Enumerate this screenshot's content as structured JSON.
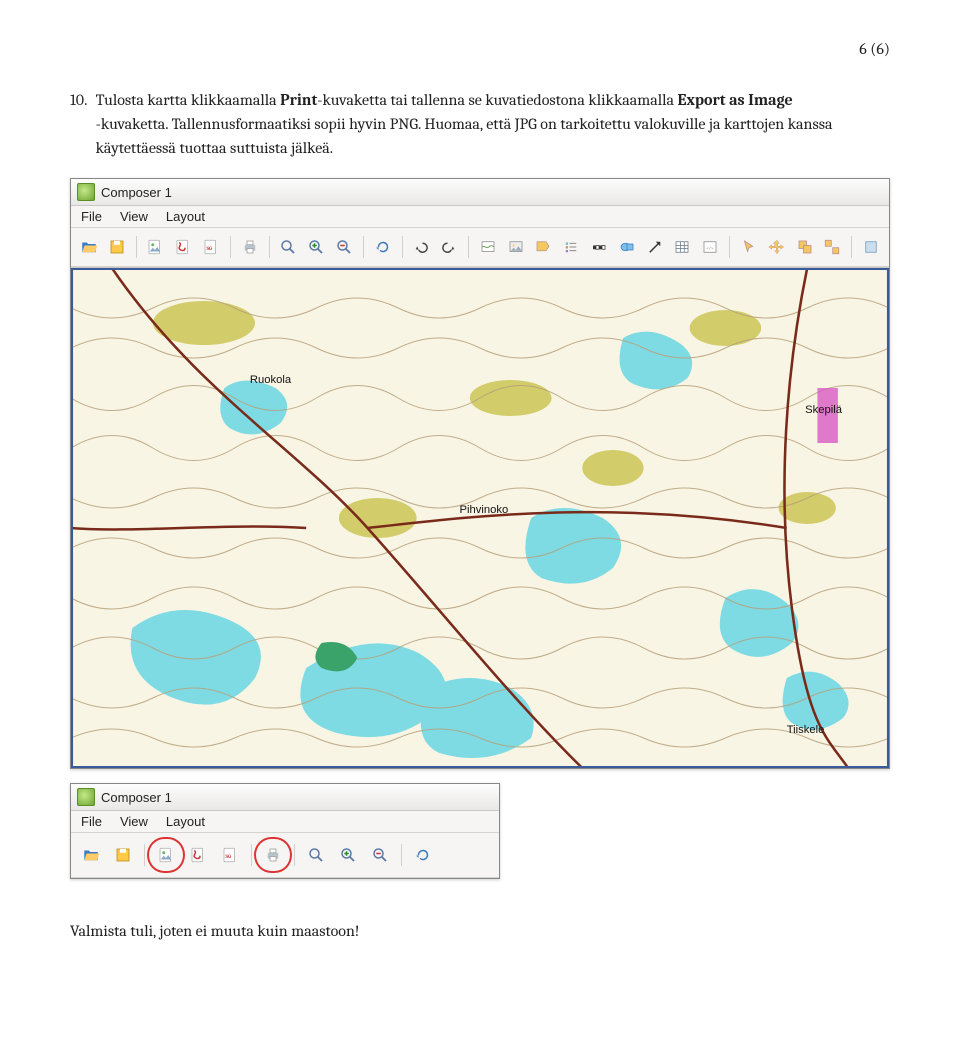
{
  "page_number": "6 (6)",
  "step": {
    "num": "10.",
    "text_before_bold1": "Tulosta kartta klikkaamalla ",
    "bold1": "Print",
    "text_mid1": "-kuvaketta tai tallenna se kuvatiedostona klikkaamalla ",
    "bold2": "Export as Image",
    "text_after_bold2": " -kuvaketta. Tallennusformaatiksi sopii hyvin PNG. Huomaa, että JPG on tarkoitettu valokuville ja karttojen kanssa käytettäessä tuottaa suttuista jälkeä."
  },
  "composer": {
    "title": "Composer 1",
    "menu": [
      "File",
      "View",
      "Layout"
    ]
  },
  "final_line": "Valmista tuli, joten ei muuta kuin maastoon!",
  "icons": {
    "folder": "folder-open-icon",
    "save_project": "save-project-icon",
    "export_image": "export-image-icon",
    "export_pdf": "export-pdf-icon",
    "export_svg": "export-svg-icon",
    "print": "print-icon",
    "zoom_full": "zoom-full-icon",
    "zoom_in": "zoom-in-icon",
    "zoom_out": "zoom-out-icon",
    "refresh": "refresh-icon",
    "undo": "undo-icon",
    "redo": "redo-icon",
    "add_map": "add-map-icon",
    "add_image": "add-image-icon",
    "add_label": "add-label-icon",
    "add_legend": "add-legend-icon",
    "add_scalebar": "add-scalebar-icon",
    "add_shape": "add-shape-icon",
    "add_arrow": "add-arrow-icon",
    "add_table": "add-table-icon",
    "add_html": "add-html-icon",
    "select": "select-move-icon",
    "move_content": "move-content-icon",
    "group": "group-icon",
    "ungroup": "ungroup-icon"
  },
  "map_labels": [
    "Ruokola",
    "Skepilä",
    "Tiiskele",
    "Pihvinoko"
  ]
}
